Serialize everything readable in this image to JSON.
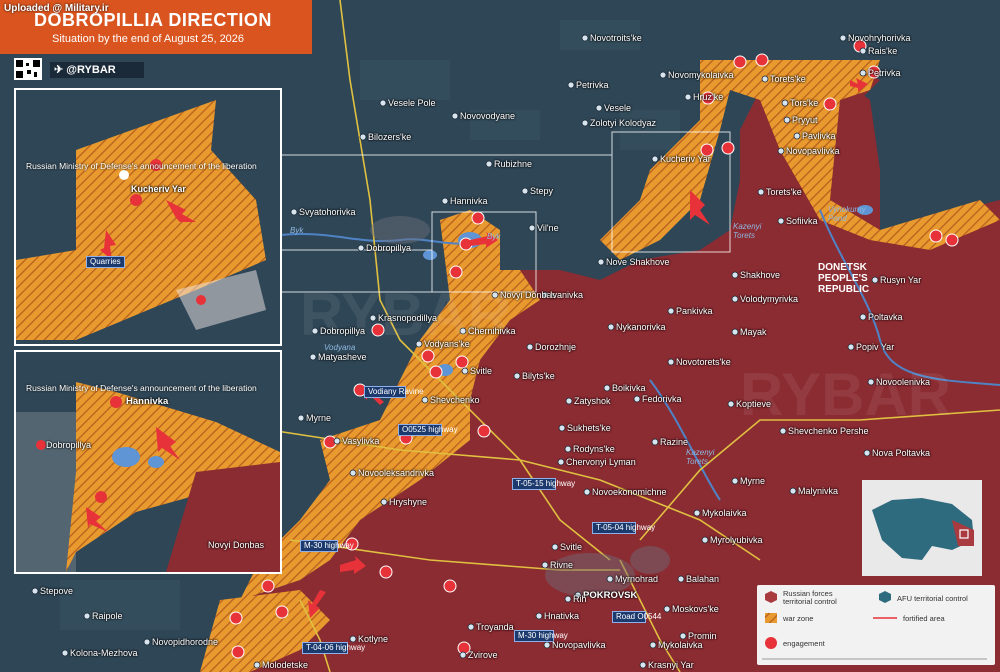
{
  "watermark": "Uploaded @ Military.ir",
  "header": {
    "title": "DOBROPILLIA DIRECTION",
    "subtitle": "Situation by the end of August 25, 2026",
    "brand": "@RYBAR"
  },
  "colors": {
    "russian_control": "#8b2b32",
    "war_zone": "#e89a2e",
    "afu_control": "#2f4656",
    "engagement": "#e8323a",
    "river": "#4f83c6",
    "header": "#d9541e"
  },
  "places": [
    {
      "name": "Novotroits'ke"
    },
    {
      "name": "Novohryhorivka"
    },
    {
      "name": "Rais'ke"
    },
    {
      "name": "Petrivka"
    },
    {
      "name": "Novomykolaivka"
    },
    {
      "name": "Torets'ke"
    },
    {
      "name": "Petrivka"
    },
    {
      "name": "Vesele Pole"
    },
    {
      "name": "Novovodyane"
    },
    {
      "name": "Vesele"
    },
    {
      "name": "Hruz'ke"
    },
    {
      "name": "Tors'ke"
    },
    {
      "name": "Zolotyi Kolodyaz"
    },
    {
      "name": "Pryyut"
    },
    {
      "name": "Bilozers'ke"
    },
    {
      "name": "Pavlivka"
    },
    {
      "name": "Novopavlivka"
    },
    {
      "name": "Rubizhne"
    },
    {
      "name": "Kucheriv Yar"
    },
    {
      "name": "Stepy"
    },
    {
      "name": "Torets'ke"
    },
    {
      "name": "Svyatohorivka"
    },
    {
      "name": "Hannivka"
    },
    {
      "name": "Sofiivka"
    },
    {
      "name": "Vil'ne"
    },
    {
      "name": "Dobropillya"
    },
    {
      "name": "Nove Shakhove"
    },
    {
      "name": "Shakhove"
    },
    {
      "name": "Rusyn Yar"
    },
    {
      "name": "Novyi Donbas"
    },
    {
      "name": "Ivanivka"
    },
    {
      "name": "Volodymyrivka"
    },
    {
      "name": "Krasnopodillya"
    },
    {
      "name": "Pankivka"
    },
    {
      "name": "Poltavka"
    },
    {
      "name": "Chernihivka"
    },
    {
      "name": "Dobropillya"
    },
    {
      "name": "Nykanorivka"
    },
    {
      "name": "Vodyans'ke"
    },
    {
      "name": "Mayak"
    },
    {
      "name": "Matyasheve"
    },
    {
      "name": "Dorozhnje"
    },
    {
      "name": "Popiv Yar"
    },
    {
      "name": "Svitle"
    },
    {
      "name": "Novotorets'ke"
    },
    {
      "name": "Bilyts'ke"
    },
    {
      "name": "Novoolenivka"
    },
    {
      "name": "Shevchenko"
    },
    {
      "name": "Boikivka"
    },
    {
      "name": "Fedorivka"
    },
    {
      "name": "Zatyshok"
    },
    {
      "name": "Koptieve"
    },
    {
      "name": "Myrne"
    },
    {
      "name": "Sukhets'ke"
    },
    {
      "name": "Vasylivka"
    },
    {
      "name": "Shevchenko Pershe"
    },
    {
      "name": "Razine"
    },
    {
      "name": "Rodyns'ke"
    },
    {
      "name": "Nova Poltavka"
    },
    {
      "name": "Chervonyi Lyman"
    },
    {
      "name": "Novooleksandrivka"
    },
    {
      "name": "Novoekonomichne"
    },
    {
      "name": "Myrne"
    },
    {
      "name": "Malynivka"
    },
    {
      "name": "Hryshyne"
    },
    {
      "name": "Mykolaivka"
    },
    {
      "name": "Svitle"
    },
    {
      "name": "Myrolyubivka"
    },
    {
      "name": "Novyi Donbas"
    },
    {
      "name": "Rivne"
    },
    {
      "name": "Myrnohrad"
    },
    {
      "name": "Balahan"
    },
    {
      "name": "POKROVSK"
    },
    {
      "name": "Rih"
    },
    {
      "name": "Stepove"
    },
    {
      "name": "Hnativka"
    },
    {
      "name": "Moskovs'ke"
    },
    {
      "name": "Raipole"
    },
    {
      "name": "Troyanda"
    },
    {
      "name": "Promin"
    },
    {
      "name": "Novopidhorodne"
    },
    {
      "name": "Novopavlivka"
    },
    {
      "name": "Mykolaivka"
    },
    {
      "name": "Kolona-Mezhova"
    },
    {
      "name": "Kotlyne"
    },
    {
      "name": "Zvirove"
    },
    {
      "name": "Krasnyi Yar"
    },
    {
      "name": "Molodetske"
    }
  ],
  "water": {
    "byk1": "Byk",
    "byk2": "Byk",
    "vodyana": "Vodyana",
    "vynokurny": "Vynokurny Pond",
    "kazenyi1": "Kazenyi Torets",
    "kazenyi2": "Kazenyi Torets"
  },
  "region_label": "DONETSK PEOPLE'S REPUBLIC",
  "roads": {
    "o0525": "O0525 highway",
    "t0515": "T-05-15 highway",
    "t0504": "T-05-04 highway",
    "m30a": "M-30 highway",
    "m30b": "M-30 highway",
    "o0544": "Road O0544",
    "t0406": "T-04-06 highway",
    "vodiany": "Vodiany Ravine"
  },
  "inset_top": {
    "note": "Russian Ministry of Defense's announcement of the liberation",
    "place": "Kucheriv Yar",
    "quarries": "Quarries"
  },
  "inset_bottom": {
    "note": "Russian Ministry of Defense's announcement of the liberation",
    "place": "Hannivka",
    "place2": "Dobropillya",
    "place3": "Novyi Donbas"
  },
  "legend": {
    "russian": "Russian forces territorial control",
    "afu": "AFU territorial control",
    "war_zone": "war zone",
    "fortified": "fortified area",
    "engagement": "engagement"
  }
}
